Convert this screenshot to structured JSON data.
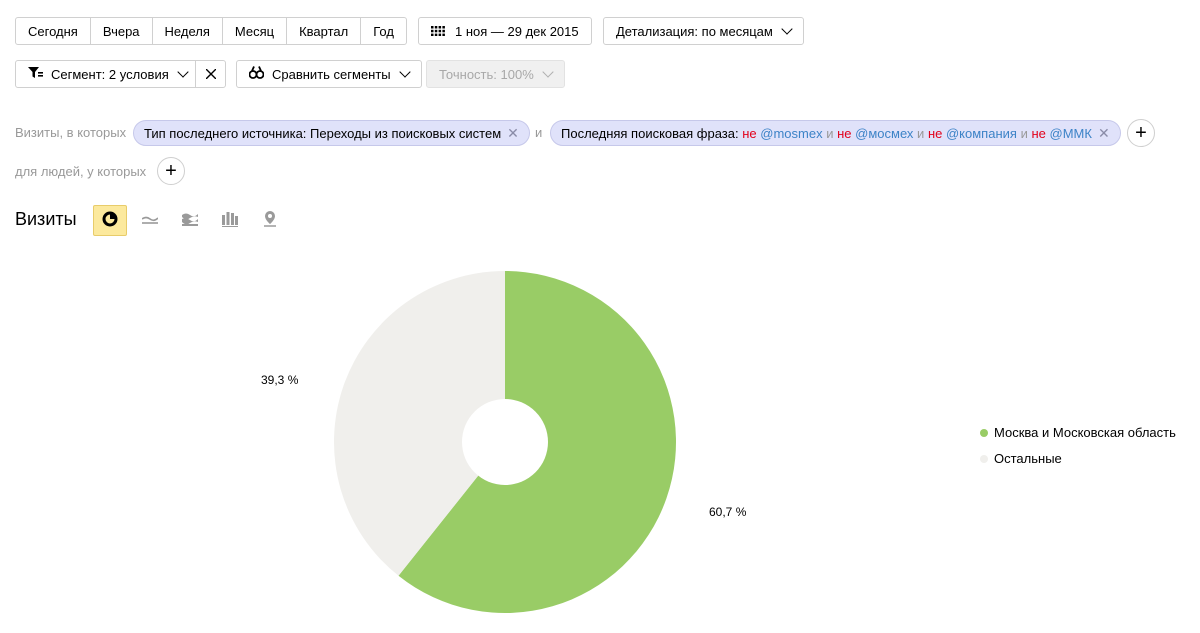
{
  "period_buttons": [
    "Сегодня",
    "Вчера",
    "Неделя",
    "Месяц",
    "Квартал",
    "Год"
  ],
  "date_range": "1 ноя — 29 дек 2015",
  "detail": "Детализация: по месяцам",
  "segment": "Сегмент: 2 условия",
  "compare": "Сравнить сегменты",
  "precision": "Точность: 100%",
  "filters": {
    "visits_label": "Визиты, в которых",
    "and_label": "и",
    "people_label": "для людей, у которых",
    "pill1": "Тип последнего источника: Переходы из поисковых систем",
    "pill2_prefix": "Последняя поисковая фраза:",
    "pill2_terms": [
      {
        "neg": "не",
        "val": "@mosmex"
      },
      {
        "neg": "не",
        "val": "@мосмех"
      },
      {
        "neg": "не",
        "val": "@компания"
      },
      {
        "neg": "не",
        "val": "@ММК"
      }
    ],
    "pill2_joiner": "и"
  },
  "section_title": "Визиты",
  "view_icons": [
    "pie-chart-icon",
    "line-chart-icon",
    "area-chart-icon",
    "bar-chart-icon",
    "map-icon"
  ],
  "chart_data": {
    "type": "pie",
    "donut": true,
    "slices": [
      {
        "name": "Москва и Московская область",
        "value": 60.7,
        "label": "60,7 %",
        "color": "#99cc66"
      },
      {
        "name": "Остальные",
        "value": 39.3,
        "label": "39,3 %",
        "color": "#f0efec"
      }
    ],
    "legend": "right"
  }
}
